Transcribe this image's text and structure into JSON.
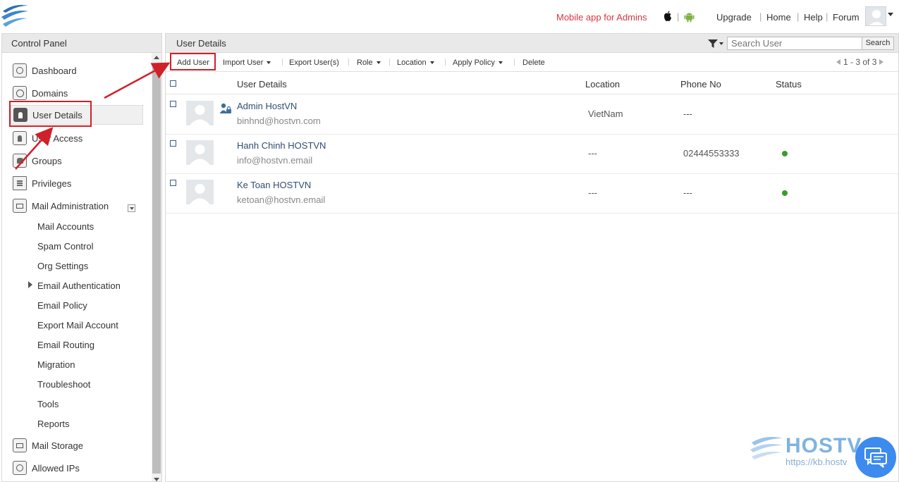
{
  "topbar": {
    "mobile_app_link": "Mobile app for Admins",
    "os_icons": [
      "apple-icon",
      "android-icon"
    ],
    "links": [
      "Upgrade",
      "Home",
      "Help",
      "Forum"
    ]
  },
  "sidebar": {
    "title": "Control Panel",
    "items": [
      {
        "label": "Dashboard",
        "icon": "dashboard-icon"
      },
      {
        "label": "Domains",
        "icon": "domains-icon"
      },
      {
        "label": "User Details",
        "icon": "user-icon",
        "active": true
      },
      {
        "label": "User Access",
        "icon": "user-access-icon"
      },
      {
        "label": "Groups",
        "icon": "groups-icon"
      },
      {
        "label": "Privileges",
        "icon": "privileges-icon"
      },
      {
        "label": "Mail Administration",
        "icon": "mail-icon"
      }
    ],
    "mail_admin_sub": [
      "Mail Accounts",
      "Spam Control",
      "Org Settings",
      "Email Authentication",
      "Email Policy",
      "Export Mail Account",
      "Email Routing",
      "Migration",
      "Troubleshoot",
      "Tools",
      "Reports"
    ],
    "bottom_items": [
      {
        "label": "Mail Storage",
        "icon": "mail-storage-icon"
      },
      {
        "label": "Allowed IPs",
        "icon": "allowed-ips-icon"
      }
    ]
  },
  "main": {
    "title": "User Details",
    "search_placeholder": "Search User",
    "search_button": "Search",
    "toolbar": {
      "add_user": "Add User",
      "import_user": "Import User",
      "export_users": "Export User(s)",
      "role": "Role",
      "location": "Location",
      "apply_policy": "Apply Policy",
      "delete": "Delete"
    },
    "pager": "1 - 3 of 3",
    "columns": [
      "User Details",
      "Location",
      "Phone No",
      "Status"
    ],
    "rows": [
      {
        "name": "Admin HostVN",
        "email": "binhnd@hostvn.com",
        "location": "VietNam",
        "phone": "---",
        "status": "",
        "admin": true
      },
      {
        "name": "Hanh Chinh HOSTVN",
        "email": "info@hostvn.email",
        "location": "---",
        "phone": "02444553333",
        "status": "active"
      },
      {
        "name": "Ke Toan HOSTVN",
        "email": "ketoan@hostvn.email",
        "location": "---",
        "phone": "---",
        "status": "active"
      }
    ]
  },
  "watermark": {
    "brand": "HOSTV",
    "url": "https://kb.hostv"
  },
  "colors": {
    "annotation_red": "#d0202a",
    "link_blue": "#2f4d72",
    "status_green": "#3a9b2c",
    "mobile_link_red": "#d9363e"
  }
}
